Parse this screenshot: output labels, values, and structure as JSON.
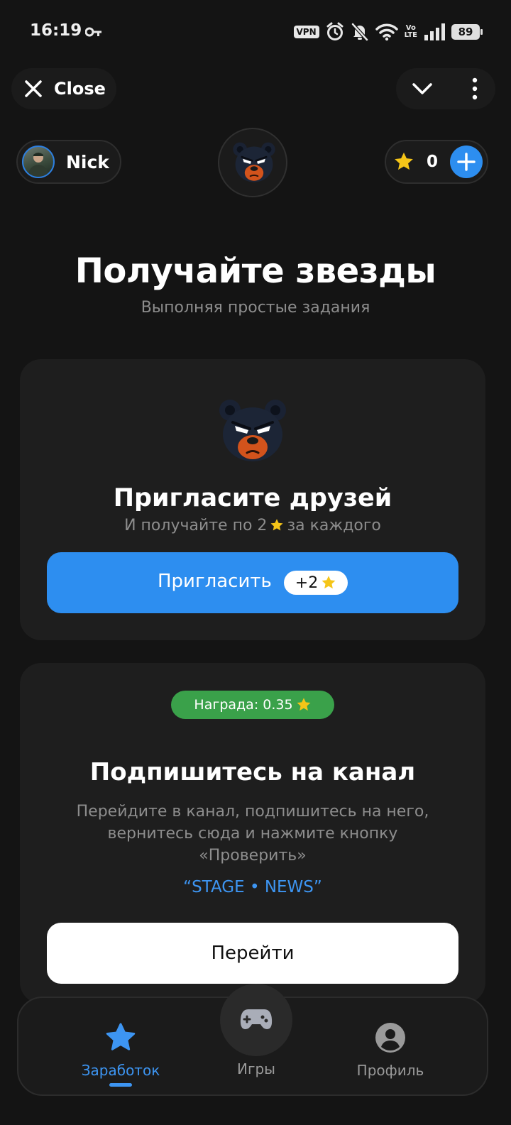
{
  "status_bar": {
    "time": "16:19",
    "vpn": "VPN",
    "volte_top": "Vo",
    "volte_bottom": "LTE",
    "battery": "89",
    "icons": [
      "key-icon",
      "vpn-icon",
      "alarm-icon",
      "bell-off-icon",
      "wifi-icon",
      "volte-icon",
      "signal-icon",
      "battery-icon"
    ]
  },
  "top_nav": {
    "close_label": "Close",
    "icons": [
      "close-icon",
      "chevron-down-icon",
      "more-vertical-icon"
    ]
  },
  "header": {
    "user_name": "Nick",
    "balance": "0",
    "icons": [
      "avatar",
      "bear-logo-icon",
      "star-icon",
      "plus-icon"
    ]
  },
  "hero": {
    "title": "Получайте звезды",
    "subtitle": "Выполняя простые задания"
  },
  "invite_card": {
    "title": "Пригласите друзей",
    "subtitle_before": "И получайте по 2",
    "subtitle_after": "за каждого",
    "button_label": "Пригласить",
    "bonus": "+2"
  },
  "task_card": {
    "reward": "Награда: 0.35",
    "title": "Подпишитесь на канал",
    "description": "Перейдите в канал, подпишитесь на него, вернитесь сюда и нажмите кнопку «Проверить»",
    "channel": "“STAGE • NEWS”",
    "button_label": "Перейти"
  },
  "bottom_nav": {
    "items": [
      {
        "label": "Заработок",
        "icon": "star-icon",
        "active": true
      },
      {
        "label": "Игры",
        "icon": "gamepad-icon",
        "active": false
      },
      {
        "label": "Профиль",
        "icon": "user-circle-icon",
        "active": false
      }
    ]
  },
  "colors": {
    "background": "#141414",
    "card": "#1e1e1e",
    "accent_blue": "#2d8ef0",
    "reward_green": "#3aa14a",
    "star_yellow": "#f5c518",
    "muted_text": "#8d8d8d"
  }
}
